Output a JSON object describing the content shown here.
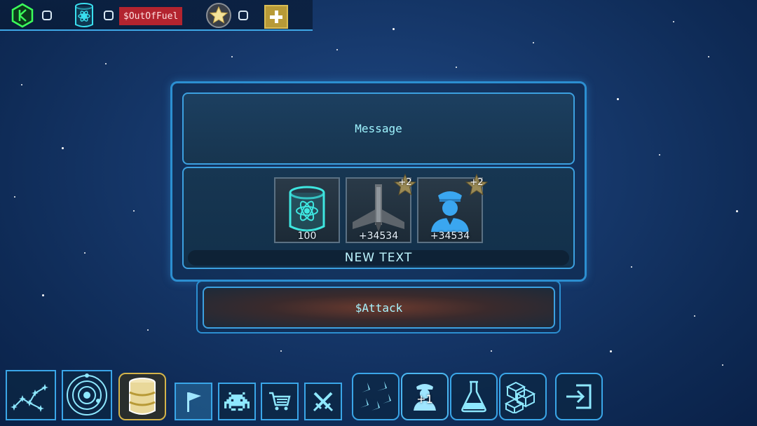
{
  "topbar": {
    "resource1_count": "",
    "fuel_count": "",
    "fuel_warning": "$OutOfFuel",
    "stars_count": ""
  },
  "dialog": {
    "message": "Message",
    "rewards": [
      {
        "icon": "fuel-barrel-icon",
        "value": "100",
        "badge": ""
      },
      {
        "icon": "spaceship-icon",
        "value": "+34534",
        "badge": "+2"
      },
      {
        "icon": "captain-icon",
        "value": "+34534",
        "badge": "+2"
      }
    ],
    "caption": "NEW TEXT",
    "attack_label": "$Attack"
  },
  "nav": {
    "left": [
      "constellation-icon",
      "solar-system-icon",
      "fuel-barrel-icon"
    ],
    "middle": [
      "flag-icon",
      "space-invader-icon",
      "cart-icon",
      "crossed-swords-icon"
    ],
    "right": [
      "fleet-icon",
      "crew-icon",
      "flask-icon",
      "cubes-icon",
      "exit-icon"
    ],
    "crew_badge": "+1"
  },
  "colors": {
    "accent": "#3aa6e8",
    "warning": "#b3242f",
    "gold": "#b89a37",
    "highlight_text": "#9ff4ff"
  }
}
